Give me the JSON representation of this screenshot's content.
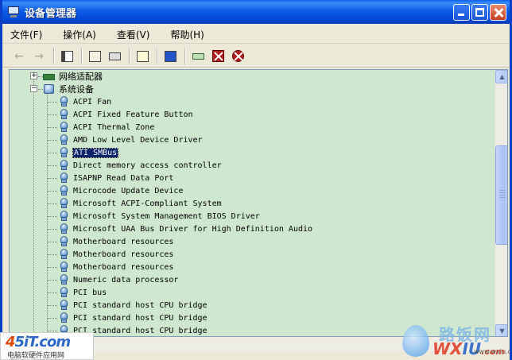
{
  "window": {
    "title": "设备管理器"
  },
  "menu": [
    {
      "label": "文件(F)"
    },
    {
      "label": "操作(A)"
    },
    {
      "label": "查看(V)"
    },
    {
      "label": "帮助(H)"
    }
  ],
  "toolbar": {
    "buttons": [
      "back-icon",
      "forward-icon",
      "show-hide-tree-icon",
      "properties-icon",
      "print-icon",
      "help-icon",
      "scan-hardware-icon",
      "update-driver-icon",
      "disable-device-icon",
      "uninstall-device-icon"
    ]
  },
  "tree": {
    "categories": [
      {
        "label": "网络适配器",
        "expanded": false,
        "icon": "network-adapter-icon"
      },
      {
        "label": "系统设备",
        "expanded": true,
        "icon": "computer-icon"
      }
    ],
    "devices": [
      {
        "label": "ACPI Fan"
      },
      {
        "label": "ACPI Fixed Feature Button"
      },
      {
        "label": "ACPI Thermal Zone"
      },
      {
        "label": "AMD Low Level Device Driver"
      },
      {
        "label": "ATI SMBus",
        "selected": true
      },
      {
        "label": "Direct memory access controller"
      },
      {
        "label": "ISAPNP Read Data Port"
      },
      {
        "label": "Microcode Update Device"
      },
      {
        "label": "Microsoft ACPI-Compliant System"
      },
      {
        "label": "Microsoft System Management BIOS Driver"
      },
      {
        "label": "Microsoft UAA Bus Driver for High Definition Audio"
      },
      {
        "label": "Motherboard resources"
      },
      {
        "label": "Motherboard resources"
      },
      {
        "label": "Motherboard resources"
      },
      {
        "label": "Numeric data processor"
      },
      {
        "label": "PCI bus"
      },
      {
        "label": "PCI standard host CPU bridge"
      },
      {
        "label": "PCI standard host CPU bridge"
      },
      {
        "label": "PCI standard host CPU bridge"
      }
    ]
  },
  "watermark_left": {
    "brand_a": "4",
    "brand_b": "5iT",
    "brand_c": ".com",
    "subtitle": "电脑软硬件应用网"
  },
  "watermark_right": {
    "cn": "路饭网",
    "en_a": "WX",
    "en_b": "IU",
    "en_c": ".com",
    "url": "www.wxiu.com"
  }
}
